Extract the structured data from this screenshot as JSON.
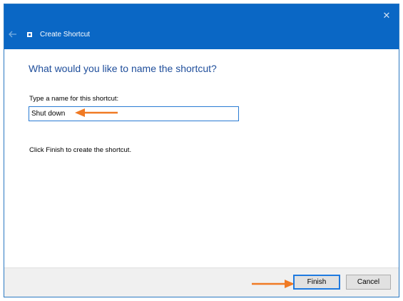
{
  "window": {
    "title": "Create Shortcut",
    "close_glyph": "✕",
    "colors": {
      "titlebar": "#0a67c5",
      "heading": "#1f4e9b",
      "accent_arrow": "#f07a24"
    }
  },
  "main": {
    "heading": "What would you like to name the shortcut?",
    "field_label": "Type a name for this shortcut:",
    "name_value": "Shut down",
    "hint": "Click Finish to create the shortcut."
  },
  "footer": {
    "finish_label": "Finish",
    "cancel_label": "Cancel"
  },
  "icons": {
    "back": "back-arrow-icon",
    "app": "shortcut-icon",
    "close": "close-icon",
    "annotation": "annotation-arrow-icon"
  }
}
